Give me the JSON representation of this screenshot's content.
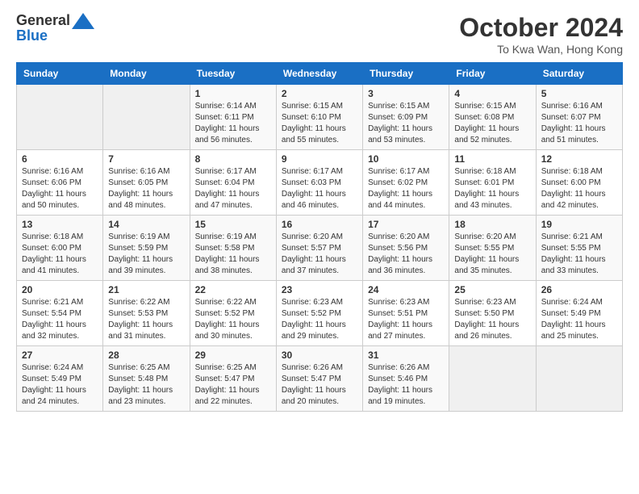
{
  "logo": {
    "line1": "General",
    "line2": "Blue"
  },
  "title": "October 2024",
  "subtitle": "To Kwa Wan, Hong Kong",
  "weekdays": [
    "Sunday",
    "Monday",
    "Tuesday",
    "Wednesday",
    "Thursday",
    "Friday",
    "Saturday"
  ],
  "weeks": [
    [
      {
        "day": "",
        "sunrise": "",
        "sunset": "",
        "daylight": ""
      },
      {
        "day": "",
        "sunrise": "",
        "sunset": "",
        "daylight": ""
      },
      {
        "day": "1",
        "sunrise": "Sunrise: 6:14 AM",
        "sunset": "Sunset: 6:11 PM",
        "daylight": "Daylight: 11 hours and 56 minutes."
      },
      {
        "day": "2",
        "sunrise": "Sunrise: 6:15 AM",
        "sunset": "Sunset: 6:10 PM",
        "daylight": "Daylight: 11 hours and 55 minutes."
      },
      {
        "day": "3",
        "sunrise": "Sunrise: 6:15 AM",
        "sunset": "Sunset: 6:09 PM",
        "daylight": "Daylight: 11 hours and 53 minutes."
      },
      {
        "day": "4",
        "sunrise": "Sunrise: 6:15 AM",
        "sunset": "Sunset: 6:08 PM",
        "daylight": "Daylight: 11 hours and 52 minutes."
      },
      {
        "day": "5",
        "sunrise": "Sunrise: 6:16 AM",
        "sunset": "Sunset: 6:07 PM",
        "daylight": "Daylight: 11 hours and 51 minutes."
      }
    ],
    [
      {
        "day": "6",
        "sunrise": "Sunrise: 6:16 AM",
        "sunset": "Sunset: 6:06 PM",
        "daylight": "Daylight: 11 hours and 50 minutes."
      },
      {
        "day": "7",
        "sunrise": "Sunrise: 6:16 AM",
        "sunset": "Sunset: 6:05 PM",
        "daylight": "Daylight: 11 hours and 48 minutes."
      },
      {
        "day": "8",
        "sunrise": "Sunrise: 6:17 AM",
        "sunset": "Sunset: 6:04 PM",
        "daylight": "Daylight: 11 hours and 47 minutes."
      },
      {
        "day": "9",
        "sunrise": "Sunrise: 6:17 AM",
        "sunset": "Sunset: 6:03 PM",
        "daylight": "Daylight: 11 hours and 46 minutes."
      },
      {
        "day": "10",
        "sunrise": "Sunrise: 6:17 AM",
        "sunset": "Sunset: 6:02 PM",
        "daylight": "Daylight: 11 hours and 44 minutes."
      },
      {
        "day": "11",
        "sunrise": "Sunrise: 6:18 AM",
        "sunset": "Sunset: 6:01 PM",
        "daylight": "Daylight: 11 hours and 43 minutes."
      },
      {
        "day": "12",
        "sunrise": "Sunrise: 6:18 AM",
        "sunset": "Sunset: 6:00 PM",
        "daylight": "Daylight: 11 hours and 42 minutes."
      }
    ],
    [
      {
        "day": "13",
        "sunrise": "Sunrise: 6:18 AM",
        "sunset": "Sunset: 6:00 PM",
        "daylight": "Daylight: 11 hours and 41 minutes."
      },
      {
        "day": "14",
        "sunrise": "Sunrise: 6:19 AM",
        "sunset": "Sunset: 5:59 PM",
        "daylight": "Daylight: 11 hours and 39 minutes."
      },
      {
        "day": "15",
        "sunrise": "Sunrise: 6:19 AM",
        "sunset": "Sunset: 5:58 PM",
        "daylight": "Daylight: 11 hours and 38 minutes."
      },
      {
        "day": "16",
        "sunrise": "Sunrise: 6:20 AM",
        "sunset": "Sunset: 5:57 PM",
        "daylight": "Daylight: 11 hours and 37 minutes."
      },
      {
        "day": "17",
        "sunrise": "Sunrise: 6:20 AM",
        "sunset": "Sunset: 5:56 PM",
        "daylight": "Daylight: 11 hours and 36 minutes."
      },
      {
        "day": "18",
        "sunrise": "Sunrise: 6:20 AM",
        "sunset": "Sunset: 5:55 PM",
        "daylight": "Daylight: 11 hours and 35 minutes."
      },
      {
        "day": "19",
        "sunrise": "Sunrise: 6:21 AM",
        "sunset": "Sunset: 5:55 PM",
        "daylight": "Daylight: 11 hours and 33 minutes."
      }
    ],
    [
      {
        "day": "20",
        "sunrise": "Sunrise: 6:21 AM",
        "sunset": "Sunset: 5:54 PM",
        "daylight": "Daylight: 11 hours and 32 minutes."
      },
      {
        "day": "21",
        "sunrise": "Sunrise: 6:22 AM",
        "sunset": "Sunset: 5:53 PM",
        "daylight": "Daylight: 11 hours and 31 minutes."
      },
      {
        "day": "22",
        "sunrise": "Sunrise: 6:22 AM",
        "sunset": "Sunset: 5:52 PM",
        "daylight": "Daylight: 11 hours and 30 minutes."
      },
      {
        "day": "23",
        "sunrise": "Sunrise: 6:23 AM",
        "sunset": "Sunset: 5:52 PM",
        "daylight": "Daylight: 11 hours and 29 minutes."
      },
      {
        "day": "24",
        "sunrise": "Sunrise: 6:23 AM",
        "sunset": "Sunset: 5:51 PM",
        "daylight": "Daylight: 11 hours and 27 minutes."
      },
      {
        "day": "25",
        "sunrise": "Sunrise: 6:23 AM",
        "sunset": "Sunset: 5:50 PM",
        "daylight": "Daylight: 11 hours and 26 minutes."
      },
      {
        "day": "26",
        "sunrise": "Sunrise: 6:24 AM",
        "sunset": "Sunset: 5:49 PM",
        "daylight": "Daylight: 11 hours and 25 minutes."
      }
    ],
    [
      {
        "day": "27",
        "sunrise": "Sunrise: 6:24 AM",
        "sunset": "Sunset: 5:49 PM",
        "daylight": "Daylight: 11 hours and 24 minutes."
      },
      {
        "day": "28",
        "sunrise": "Sunrise: 6:25 AM",
        "sunset": "Sunset: 5:48 PM",
        "daylight": "Daylight: 11 hours and 23 minutes."
      },
      {
        "day": "29",
        "sunrise": "Sunrise: 6:25 AM",
        "sunset": "Sunset: 5:47 PM",
        "daylight": "Daylight: 11 hours and 22 minutes."
      },
      {
        "day": "30",
        "sunrise": "Sunrise: 6:26 AM",
        "sunset": "Sunset: 5:47 PM",
        "daylight": "Daylight: 11 hours and 20 minutes."
      },
      {
        "day": "31",
        "sunrise": "Sunrise: 6:26 AM",
        "sunset": "Sunset: 5:46 PM",
        "daylight": "Daylight: 11 hours and 19 minutes."
      },
      {
        "day": "",
        "sunrise": "",
        "sunset": "",
        "daylight": ""
      },
      {
        "day": "",
        "sunrise": "",
        "sunset": "",
        "daylight": ""
      }
    ]
  ]
}
